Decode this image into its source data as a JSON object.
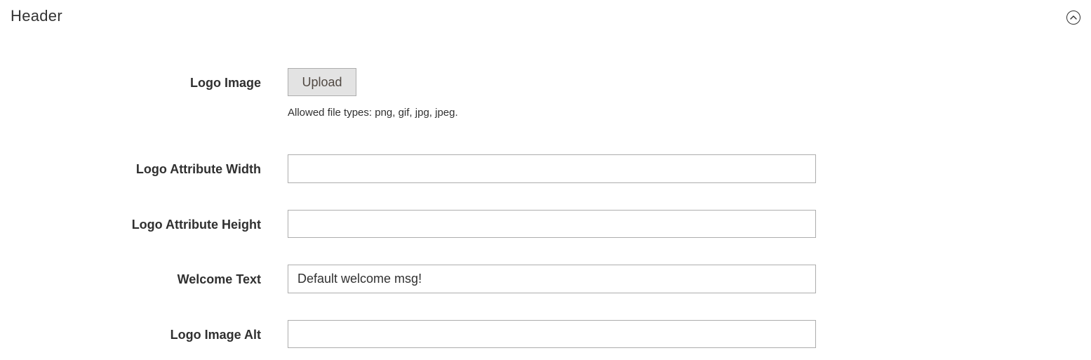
{
  "section": {
    "title": "Header",
    "toggle_icon": "chevron-up-circle-icon"
  },
  "fields": {
    "logo_image": {
      "label": "Logo Image",
      "button_label": "Upload",
      "hint": "Allowed file types: png, gif, jpg, jpeg."
    },
    "logo_width": {
      "label": "Logo Attribute Width",
      "value": ""
    },
    "logo_height": {
      "label": "Logo Attribute Height",
      "value": ""
    },
    "welcome_text": {
      "label": "Welcome Text",
      "value": "Default welcome msg!"
    },
    "logo_alt": {
      "label": "Logo Image Alt",
      "value": ""
    }
  }
}
